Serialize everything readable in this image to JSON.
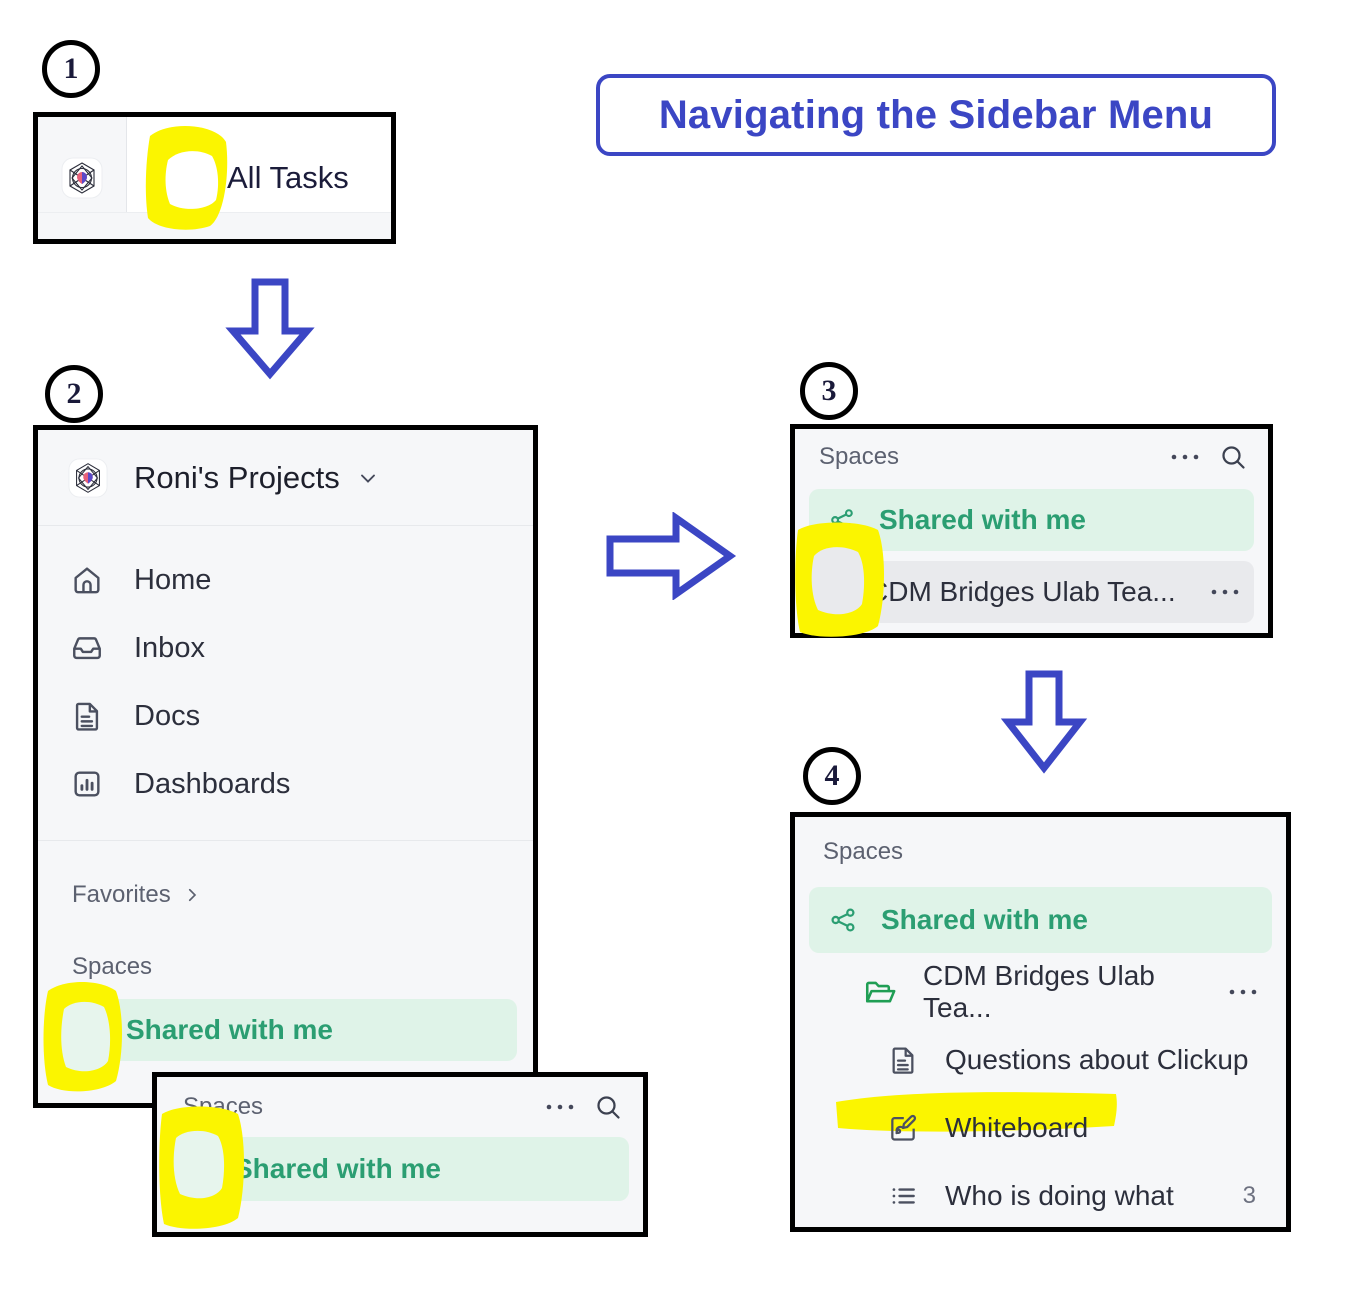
{
  "title": {
    "text": "Navigating the Sidebar Menu",
    "color": "#3b46c4"
  },
  "steps": {
    "one": "1",
    "two": "2",
    "three": "3",
    "four": "4"
  },
  "panel1": {
    "logo_icon": "clickup-workspace-logo-icon",
    "view_icon": "all-tasks-panel-icon",
    "label": "All Tasks"
  },
  "panel2": {
    "workspace": {
      "name": "Roni's Projects",
      "avatar_icon": "workspace-avatar-icon",
      "chevron_icon": "chevron-down-icon"
    },
    "nav": [
      {
        "label": "Home",
        "icon": "home-icon"
      },
      {
        "label": "Inbox",
        "icon": "inbox-icon"
      },
      {
        "label": "Docs",
        "icon": "docs-icon"
      },
      {
        "label": "Dashboards",
        "icon": "dashboards-icon"
      }
    ],
    "favorites": {
      "label": "Favorites",
      "caret_icon": "chevron-right-icon"
    },
    "spaces_label": "Spaces",
    "shared": {
      "label": "Shared with me",
      "icon": "share-nodes-icon"
    }
  },
  "panel_small": {
    "header": "Spaces",
    "more_icon": "ellipsis-icon",
    "search_icon": "search-icon",
    "shared": {
      "label": "Shared with me",
      "toggle_icon": "triangle-right-icon"
    }
  },
  "panel3": {
    "header": "Spaces",
    "more_icon": "ellipsis-icon",
    "search_icon": "search-icon",
    "shared": {
      "label": "Shared with me",
      "icon": "share-nodes-icon"
    },
    "folder": {
      "label": "CDM Bridges Ulab Tea...",
      "toggle_icon": "triangle-right-icon",
      "more_icon": "ellipsis-icon"
    }
  },
  "panel4": {
    "header": "Spaces",
    "shared": {
      "label": "Shared with me",
      "icon": "share-nodes-icon"
    },
    "folder": {
      "label": "CDM Bridges Ulab Tea...",
      "icon": "folder-open-icon",
      "more_icon": "ellipsis-icon"
    },
    "items": [
      {
        "label": "Questions about Clickup",
        "icon": "doc-icon",
        "count": ""
      },
      {
        "label": "Whiteboard",
        "icon": "whiteboard-icon",
        "count": ""
      },
      {
        "label": "Who is doing what",
        "icon": "list-icon",
        "count": "3"
      }
    ]
  },
  "colors": {
    "accent_blue": "#3b46c4",
    "green": "#2b9e72",
    "green_bg": "#dff3e8",
    "highlighter": "#fbf500",
    "panel_bg": "#f6f7f9"
  }
}
